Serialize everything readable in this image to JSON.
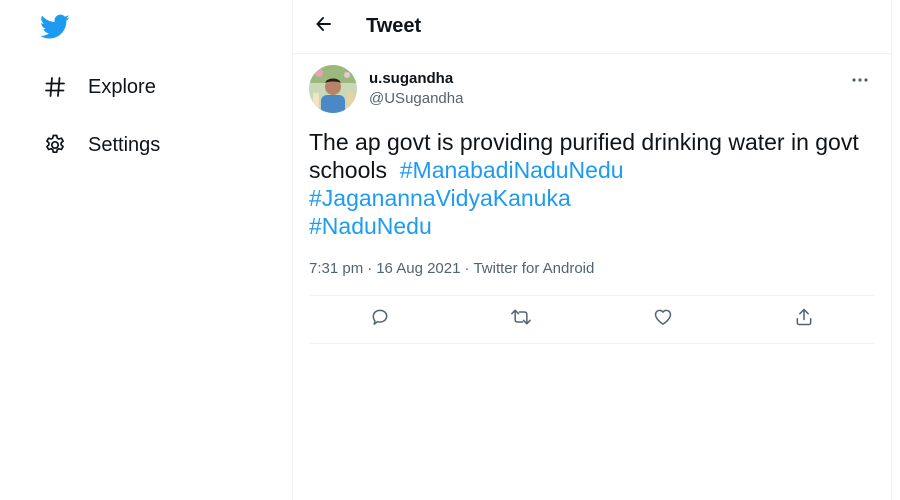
{
  "sidebar": {
    "logo_icon": "twitter-bird-icon",
    "items": [
      {
        "label": "Explore",
        "icon": "hashtag-icon"
      },
      {
        "label": "Settings",
        "icon": "gear-icon"
      }
    ]
  },
  "header": {
    "title": "Tweet",
    "back_icon": "arrow-left-icon"
  },
  "tweet": {
    "display_name": "u.sugandha",
    "handle": "@USugandha",
    "text_line1": "The ap govt is providing purified drinking water in govt",
    "text_line2_plain": "schools ",
    "hashtags": [
      "#ManabadiNaduNedu",
      "#JaganannaVidyaKanuka",
      "#NaduNedu"
    ],
    "time": "7:31 pm",
    "date": "16 Aug 2021",
    "source": "Twitter for Android",
    "separator": "·"
  },
  "actions": [
    {
      "name": "reply",
      "icon": "reply-icon"
    },
    {
      "name": "retweet",
      "icon": "retweet-icon"
    },
    {
      "name": "like",
      "icon": "heart-icon"
    },
    {
      "name": "share",
      "icon": "share-icon"
    }
  ],
  "colors": {
    "brand": "#1d9bf0",
    "text_primary": "#0f1419",
    "text_secondary": "#536471",
    "border": "#eff3f4"
  }
}
